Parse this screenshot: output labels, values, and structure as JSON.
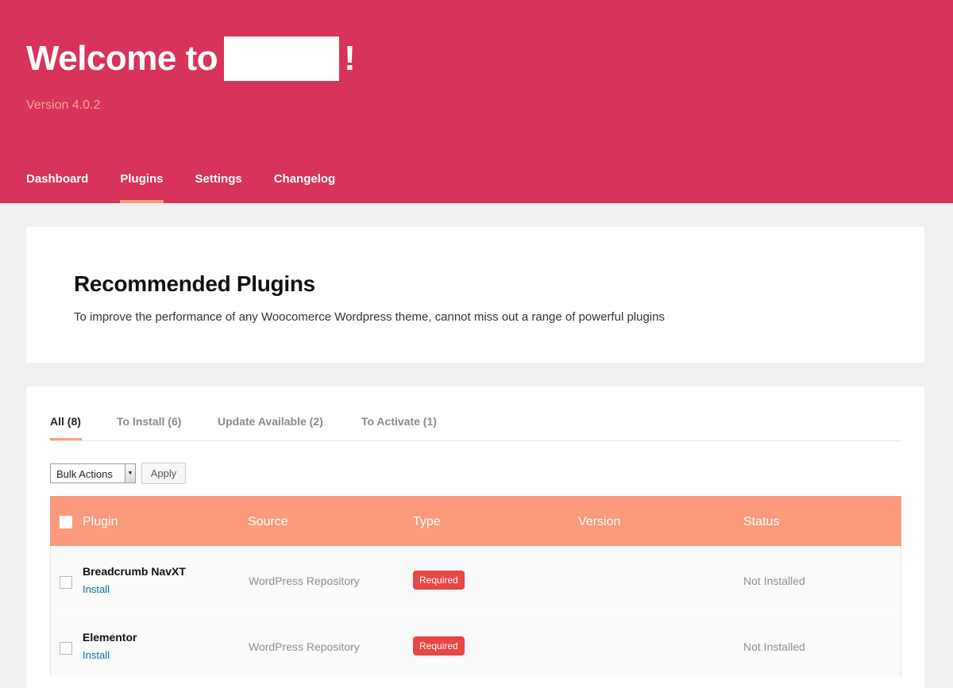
{
  "header": {
    "welcome_prefix": "Welcome to",
    "welcome_suffix": "!",
    "version": "Version 4.0.2",
    "nav": [
      {
        "label": "Dashboard"
      },
      {
        "label": "Plugins"
      },
      {
        "label": "Settings"
      },
      {
        "label": "Changelog"
      }
    ],
    "active_nav": "Plugins"
  },
  "intro": {
    "title": "Recommended Plugins",
    "text": "To improve the performance of any Woocomerce Wordpress theme, cannot miss out a range of powerful plugins"
  },
  "filters": [
    {
      "label": "All (8)"
    },
    {
      "label": "To Install (6)"
    },
    {
      "label": "Update Available (2)"
    },
    {
      "label": "To Activate (1)"
    }
  ],
  "active_filter": "All (8)",
  "bulk": {
    "selected": "Bulk Actions",
    "apply_label": "Apply"
  },
  "table": {
    "columns": [
      "Plugin",
      "Source",
      "Type",
      "Version",
      "Status"
    ],
    "rows": [
      {
        "name": "Breadcrumb NavXT",
        "action": "Install",
        "source": "WordPress Repository",
        "type": "Required",
        "version": "",
        "status": "Not Installed"
      },
      {
        "name": "Elementor",
        "action": "Install",
        "source": "WordPress Repository",
        "type": "Required",
        "version": "",
        "status": "Not Installed"
      }
    ]
  },
  "colors": {
    "header_bg": "#d8335b",
    "accent": "#fd9e80",
    "table_header": "#fb9a7c",
    "badge_required": "#e84545",
    "link": "#0073aa"
  },
  "icons": {
    "bulk_dropdown": "triangle-down-icon"
  }
}
